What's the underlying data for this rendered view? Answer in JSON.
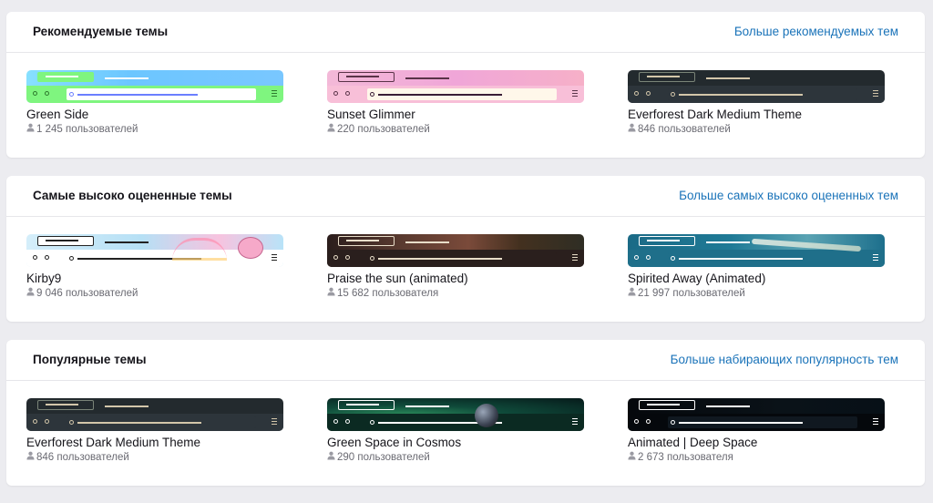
{
  "sections": [
    {
      "title": "Рекомендуемые темы",
      "link": "Больше рекомендуемых тем",
      "cards": [
        {
          "name": "Green Side",
          "users": "1 245 пользователей",
          "bg": "linear-gradient(90deg,#87e0ff 0%,#6cc6ff 40%,#79c7ff 100%)",
          "nav": "#7ff57f",
          "url": "#ffffff",
          "fg": "#2d7a2d",
          "line": "#6b7fff",
          "tabBox": "#7ff57f",
          "tabFill": "#7ff57f",
          "tabLine": "#ffffff"
        },
        {
          "name": "Sunset Glimmer",
          "users": "220 пользователей",
          "bg": "linear-gradient(90deg,#f3b9d8 0%,#f0a6d8 50%,#f6b0c8 100%)",
          "nav": "#f8bfd8",
          "url": "#fff7ea",
          "fg": "#5a3348",
          "line": "#3a1c35",
          "tabBox": "#5a3348",
          "tabFill": "transparent",
          "tabLine": "#5a3348"
        },
        {
          "name": "Everforest Dark Medium Theme",
          "users": "846 пользователей",
          "bg": "linear-gradient(90deg,#232a2e 0%,#232a2e 100%)",
          "nav": "#2d353b",
          "url": "#2d353b",
          "fg": "#d3c6aa",
          "line": "#d3c6aa",
          "tabBox": "#7a8478",
          "tabFill": "transparent",
          "tabLine": "#d3c6aa"
        }
      ]
    },
    {
      "title": "Самые высоко оцененные темы",
      "link": "Больше самых высоко оцененных тем",
      "cards": [
        {
          "name": "Kirby9",
          "users": "9 046 пользователей",
          "bg": "linear-gradient(90deg,#d5eefa 0%,#b6e0f5 45%,#f7c3df 75%,#b8e3f8 100%)",
          "nav": "#ffffff",
          "url": "#ffffff",
          "fg": "#222222",
          "line": "#222222",
          "tabBox": "#222222",
          "tabFill": "#ffffff",
          "tabLine": "#222222",
          "deco": "kirby"
        },
        {
          "name": "Praise the sun (animated)",
          "users": "15 682 пользователя",
          "bg": "linear-gradient(90deg,#2b1d1c 0%,#5b3b30 30%,#7a4a3a 55%,#43301f 75%,#2f2e24 100%)",
          "nav": "#2a1f1d",
          "url": "#2a1f1d",
          "fg": "#e8ddc8",
          "line": "#e8ddc8",
          "tabBox": "#e8ddc8",
          "tabFill": "transparent",
          "tabLine": "#e8ddc8"
        },
        {
          "name": "Spirited Away (Animated)",
          "users": "21 997 пользователей",
          "bg": "linear-gradient(90deg,#1b6a86 0%,#1f7a96 40%,#5aa3b3 70%,#1d6f8c 100%)",
          "nav": "#1f6f8a",
          "url": "#1f6f8a",
          "fg": "#ffffff",
          "line": "#ffffff",
          "tabBox": "#ffffff",
          "tabFill": "transparent",
          "tabLine": "#ffffff",
          "deco": "train"
        }
      ]
    },
    {
      "title": "Популярные темы",
      "link": "Больше набирающих популярность тем",
      "cards": [
        {
          "name": "Everforest Dark Medium Theme",
          "users": "846 пользователей",
          "bg": "linear-gradient(90deg,#232a2e 0%,#232a2e 100%)",
          "nav": "#2d353b",
          "url": "#2d353b",
          "fg": "#d3c6aa",
          "line": "#d3c6aa",
          "tabBox": "#7a8478",
          "tabFill": "transparent",
          "tabLine": "#d3c6aa"
        },
        {
          "name": "Green Space in Cosmos",
          "users": "290 пользователей",
          "bg": "radial-gradient(ellipse at 30% 50%,#2a8a5a 0%,#0f4a3a 40%,#061a1a 100%)",
          "nav": "#0b2a22",
          "url": "#0b2a22",
          "fg": "#ffffff",
          "line": "#ffffff",
          "tabBox": "#ffffff",
          "tabFill": "transparent",
          "tabLine": "#ffffff",
          "deco": "planet"
        },
        {
          "name": "Animated | Deep Space",
          "users": "2 673 пользователя",
          "bg": "linear-gradient(90deg,#05080c 0%,#0a1218 60%,#071017 100%)",
          "nav": "#05080c",
          "url": "#101820",
          "fg": "#ffffff",
          "line": "#ffffff",
          "tabBox": "#ffffff",
          "tabFill": "transparent",
          "tabLine": "#ffffff"
        }
      ]
    }
  ]
}
